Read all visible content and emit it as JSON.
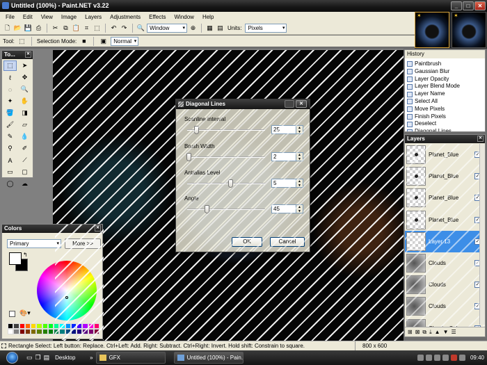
{
  "window": {
    "title": "Untitled (100%) - Paint.NET v3.22"
  },
  "menu": [
    "File",
    "Edit",
    "View",
    "Image",
    "Layers",
    "Adjustments",
    "Effects",
    "Window",
    "Help"
  ],
  "toolbar": {
    "window_dropdown": "Window",
    "units_label": "Units:",
    "units_value": "Pixels"
  },
  "toolbar2": {
    "tool_label": "Tool:",
    "selection_mode_label": "Selection Mode:",
    "blend_value": "Normal"
  },
  "tools_panel": {
    "title": "To..."
  },
  "colors_panel": {
    "title": "Colors",
    "primary_dropdown": "Primary",
    "more_button": "More >>",
    "palette": [
      "#000000",
      "#404040",
      "#ff0000",
      "#ff6a00",
      "#ffd800",
      "#b6ff00",
      "#4cff00",
      "#00ff21",
      "#00ff90",
      "#00ffff",
      "#0094ff",
      "#0026ff",
      "#4800ff",
      "#b200ff",
      "#ff00dc",
      "#ff006e",
      "#ffffff",
      "#808080",
      "#7f0000",
      "#7f3300",
      "#7f6a00",
      "#5b7f00",
      "#267f00",
      "#007f0e",
      "#007f46",
      "#007f7f",
      "#004a7f",
      "#00137f",
      "#21007f",
      "#57007f",
      "#7f006e",
      "#7f0037"
    ]
  },
  "history_panel": {
    "title": "History",
    "items": [
      "Paintbrush",
      "Gaussian Blur",
      "Layer Opacity",
      "Layer Blend Mode",
      "Layer Name",
      "Select All",
      "Move Pixels",
      "Finish Pixels",
      "Deselect",
      "Diagonal Lines"
    ]
  },
  "layers_panel": {
    "title": "Layers",
    "items": [
      {
        "name": "Planet_Blue",
        "thumb": "planet",
        "visible": true,
        "active": false
      },
      {
        "name": "Planet_Blue",
        "thumb": "planet",
        "visible": true,
        "active": false
      },
      {
        "name": "Planet_Blue",
        "thumb": "planet",
        "visible": true,
        "active": false
      },
      {
        "name": "Planet_Blue",
        "thumb": "planet",
        "visible": true,
        "active": false
      },
      {
        "name": "Layer 13",
        "thumb": "blank",
        "visible": true,
        "active": true
      },
      {
        "name": "Clouds",
        "thumb": "clouds",
        "visible": true,
        "active": false
      },
      {
        "name": "Clouds",
        "thumb": "clouds",
        "visible": true,
        "active": false
      },
      {
        "name": "Clouds",
        "thumb": "clouds",
        "visible": true,
        "active": false
      },
      {
        "name": "Clouds_Color",
        "thumb": "clouds",
        "visible": true,
        "active": false
      }
    ]
  },
  "dialog": {
    "title": "Diagonal Lines",
    "fields": [
      {
        "label": "Scanline Interval",
        "value": "25",
        "slider_fraction": 0.12
      },
      {
        "label": "Brush Width",
        "value": "2",
        "slider_fraction": 0.02
      },
      {
        "label": "Antialias Level",
        "value": "5",
        "slider_fraction": 0.55
      },
      {
        "label": "Angle",
        "value": "45",
        "slider_fraction": 0.25
      }
    ],
    "ok_label": "OK",
    "cancel_label": "Cancel"
  },
  "statusbar": {
    "hint": "Rectangle Select: Left button: Replace. Ctrl+Left: Add. Right: Subtract. Ctrl+Right: Invert. Hold shift: Constrain to square.",
    "size": "800 x 600"
  },
  "taskbar": {
    "desktop_label": "Desktop",
    "items": [
      "GFX",
      "Untitled (100%) - Pain..."
    ],
    "clock": "09:40"
  }
}
